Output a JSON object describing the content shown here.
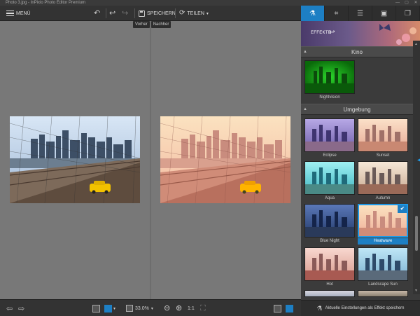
{
  "window": {
    "title": "Photo 3.jpg - InPixio Photo Editor Premium",
    "controls": [
      "—",
      "▢",
      "✕"
    ]
  },
  "toolbar": {
    "menu_label": "MENÜ",
    "save_label": "SPEICHERN",
    "share_label": "TEILEN",
    "share_caret": "▾"
  },
  "compare": {
    "before_label": "Vorher",
    "after_label": "Nachher"
  },
  "bottombar": {
    "zoom_value": "33.0%",
    "zoom_caret": "▾",
    "layout_caret": "▾",
    "fit_label": "1:1"
  },
  "panel": {
    "effects_label": "EFFEKTE",
    "sections": [
      {
        "title": "Kino"
      },
      {
        "title": "Umgebung"
      }
    ],
    "kino_effects": [
      {
        "label": "Nightvision"
      }
    ],
    "umgebung_effects": [
      {
        "label": "Eclipse"
      },
      {
        "label": "Sunset"
      },
      {
        "label": "Aqua"
      },
      {
        "label": "Autumn"
      },
      {
        "label": "Blue Night"
      },
      {
        "label": "Heatwave",
        "selected": true
      },
      {
        "label": "Hot"
      },
      {
        "label": "Landscape Sun"
      }
    ],
    "save_effect_label": "Aktuelle Einstellungen als Effekt speichern"
  },
  "colors": {
    "accent": "#1d7fc4",
    "canvas": "#787878",
    "panel": "#3b3b3b"
  }
}
